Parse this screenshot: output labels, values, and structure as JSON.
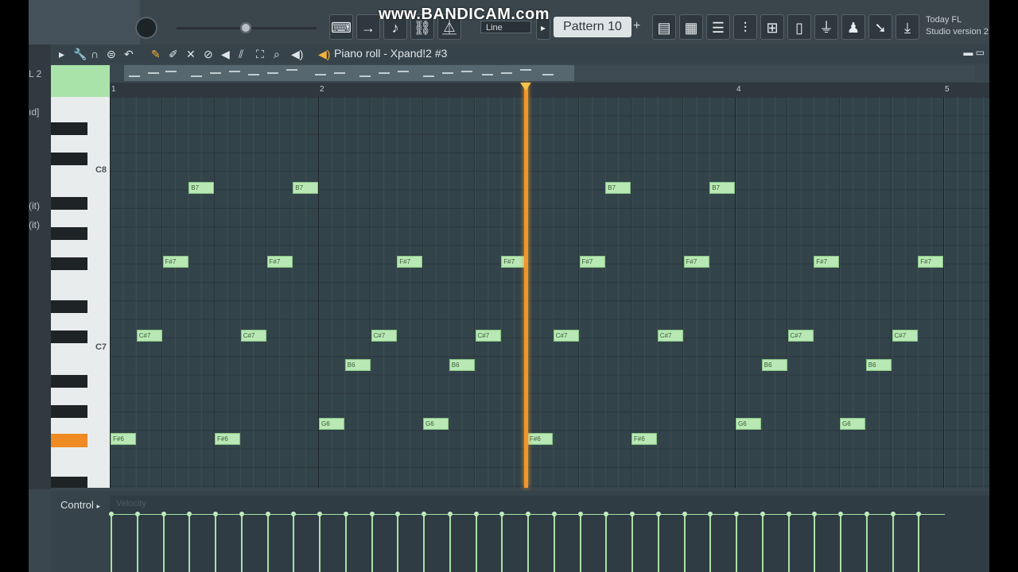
{
  "watermark": "www.BANDICAM.com",
  "toolbar": {
    "line_mode": "Line",
    "pattern_label": "Pattern 10",
    "pattern_add": "+",
    "news_line1": "Today  FL",
    "news_line2": "Studio version 2"
  },
  "piano_roll": {
    "title": "Piano roll - Xpand!2 #3",
    "ruler_numbers": [
      "1",
      "2",
      "4",
      "5"
    ],
    "key_labels": [
      "C8",
      "C7"
    ],
    "side_labels": [
      "L 2",
      "ıd]",
      "(it)",
      "(it)"
    ]
  },
  "control": {
    "label": "Control",
    "velocity_label": "Velocity"
  },
  "notes": [
    {
      "pitch": "F#6",
      "step": 0
    },
    {
      "pitch": "C#7",
      "step": 1
    },
    {
      "pitch": "F#7",
      "step": 2
    },
    {
      "pitch": "B7",
      "step": 3
    },
    {
      "pitch": "F#6",
      "step": 4
    },
    {
      "pitch": "C#7",
      "step": 5
    },
    {
      "pitch": "F#7",
      "step": 6
    },
    {
      "pitch": "B7",
      "step": 7
    },
    {
      "pitch": "G6",
      "step": 8
    },
    {
      "pitch": "B6",
      "step": 9
    },
    {
      "pitch": "C#7",
      "step": 10
    },
    {
      "pitch": "F#7",
      "step": 11
    },
    {
      "pitch": "G6",
      "step": 12
    },
    {
      "pitch": "B6",
      "step": 13
    },
    {
      "pitch": "C#7",
      "step": 14
    },
    {
      "pitch": "F#7",
      "step": 15
    },
    {
      "pitch": "F#6",
      "step": 16
    },
    {
      "pitch": "C#7",
      "step": 17
    },
    {
      "pitch": "F#7",
      "step": 18
    },
    {
      "pitch": "B7",
      "step": 19
    },
    {
      "pitch": "F#6",
      "step": 20
    },
    {
      "pitch": "C#7",
      "step": 21
    },
    {
      "pitch": "F#7",
      "step": 22
    },
    {
      "pitch": "B7",
      "step": 23
    },
    {
      "pitch": "G6",
      "step": 24
    },
    {
      "pitch": "B6",
      "step": 25
    },
    {
      "pitch": "C#7",
      "step": 26
    },
    {
      "pitch": "F#7",
      "step": 27
    },
    {
      "pitch": "G6",
      "step": 28
    },
    {
      "pitch": "B6",
      "step": 29
    },
    {
      "pitch": "C#7",
      "step": 30
    },
    {
      "pitch": "F#7",
      "step": 31
    }
  ]
}
